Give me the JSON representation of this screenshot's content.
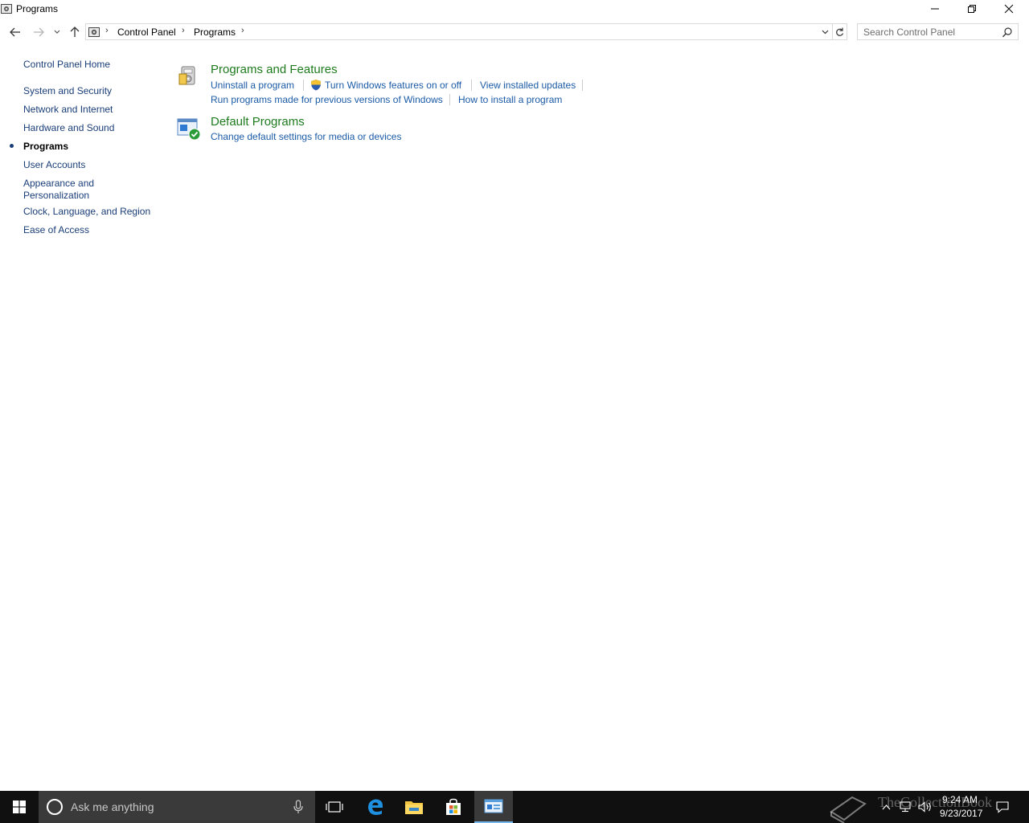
{
  "window": {
    "title": "Programs"
  },
  "address": {
    "breadcrumb": [
      "Control Panel",
      "Programs"
    ],
    "search_placeholder": "Search Control Panel"
  },
  "sidebar": {
    "home": "Control Panel Home",
    "items": [
      {
        "label": "System and Security",
        "current": false
      },
      {
        "label": "Network and Internet",
        "current": false
      },
      {
        "label": "Hardware and Sound",
        "current": false
      },
      {
        "label": "Programs",
        "current": true
      },
      {
        "label": "User Accounts",
        "current": false
      },
      {
        "label": "Appearance and Personalization",
        "current": false
      },
      {
        "label": "Clock, Language, and Region",
        "current": false
      },
      {
        "label": "Ease of Access",
        "current": false
      }
    ],
    "appearance_line1": "Appearance and",
    "appearance_line2": "Personalization"
  },
  "categories": [
    {
      "title": "Programs and Features",
      "links": [
        "Uninstall a program",
        "Turn Windows features on or off",
        "View installed updates",
        "Run programs made for previous versions of Windows",
        "How to install a program"
      ]
    },
    {
      "title": "Default Programs",
      "links": [
        "Change default settings for media or devices"
      ]
    }
  ],
  "taskbar": {
    "search_placeholder": "Ask me anything",
    "time": "9:24 AM",
    "date": "9/23/2017",
    "watermark": "TheCollectionBook"
  },
  "colors": {
    "category_title": "#1e7b1e",
    "link": "#1a5aa6",
    "sidebar_link": "#1a3e78",
    "taskbar": "#101010"
  }
}
